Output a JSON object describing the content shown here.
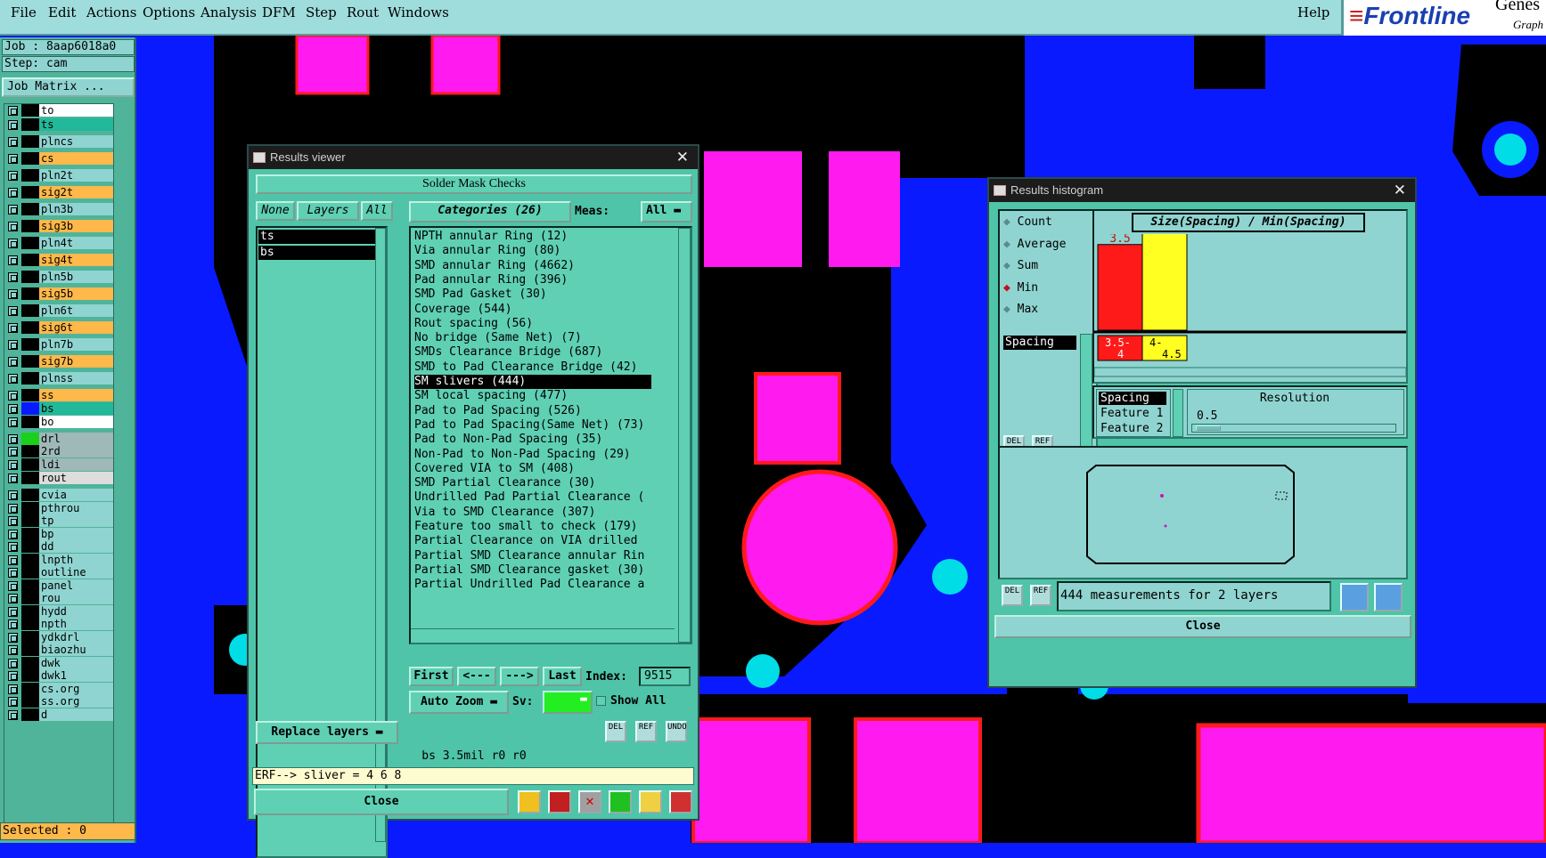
{
  "menubar": {
    "items": [
      "File",
      "Edit",
      "Actions",
      "Options",
      "Analysis",
      "DFM",
      "Step",
      "Rout",
      "Windows"
    ],
    "help": "Help",
    "logo": {
      "brand": "Frontline",
      "suffix_top": "Genes",
      "suffix_bottom": "Graph"
    }
  },
  "job": {
    "job_line": "Job : 8aap6018a0",
    "step_line": "Step: cam",
    "matrix_button": "Job Matrix ..."
  },
  "layers": [
    {
      "name": "to",
      "color": "#ffffff",
      "swatch": "#000000"
    },
    {
      "name": "ts",
      "color": "#22b89a",
      "swatch": "#000000"
    },
    {
      "name": "plncs",
      "color": "#8fd4d0",
      "swatch": "#000000"
    },
    {
      "name": "cs",
      "color": "#ffb84a",
      "swatch": "#000000"
    },
    {
      "name": "pln2t",
      "color": "#8fd4d0",
      "swatch": "#000000"
    },
    {
      "name": "sig2t",
      "color": "#ffb84a",
      "swatch": "#000000"
    },
    {
      "name": "pln3b",
      "color": "#8fd4d0",
      "swatch": "#000000"
    },
    {
      "name": "sig3b",
      "color": "#ffb84a",
      "swatch": "#000000"
    },
    {
      "name": "pln4t",
      "color": "#8fd4d0",
      "swatch": "#000000"
    },
    {
      "name": "sig4t",
      "color": "#ffb84a",
      "swatch": "#000000"
    },
    {
      "name": "pln5b",
      "color": "#8fd4d0",
      "swatch": "#000000"
    },
    {
      "name": "sig5b",
      "color": "#ffb84a",
      "swatch": "#000000"
    },
    {
      "name": "pln6t",
      "color": "#8fd4d0",
      "swatch": "#000000"
    },
    {
      "name": "sig6t",
      "color": "#ffb84a",
      "swatch": "#000000"
    },
    {
      "name": "pln7b",
      "color": "#8fd4d0",
      "swatch": "#000000"
    },
    {
      "name": "sig7b",
      "color": "#ffb84a",
      "swatch": "#000000"
    },
    {
      "name": "plnss",
      "color": "#8fd4d0",
      "swatch": "#000000"
    },
    {
      "name": "ss",
      "color": "#ffb84a",
      "swatch": "#000000"
    },
    {
      "name": "bs",
      "color": "#22b89a",
      "swatch": "#0a1aff"
    },
    {
      "name": "bo",
      "color": "#ffffff",
      "swatch": "#000000"
    },
    {
      "name": "drl",
      "color": "#9fb8b8",
      "swatch": "#1ad01a"
    },
    {
      "name": "2rd",
      "color": "#9fb8b8",
      "swatch": "#000000"
    },
    {
      "name": "ldi",
      "color": "#9fb8b8",
      "swatch": "#000000"
    },
    {
      "name": "rout",
      "color": "#dddddd",
      "swatch": "#000000"
    },
    {
      "name": "cvia",
      "color": "#8fd4d0",
      "swatch": "#000000"
    },
    {
      "name": "pthrou",
      "color": "#8fd4d0",
      "swatch": "#000000"
    },
    {
      "name": "tp",
      "color": "#8fd4d0",
      "swatch": "#000000"
    },
    {
      "name": "bp",
      "color": "#8fd4d0",
      "swatch": "#000000"
    },
    {
      "name": "dd",
      "color": "#8fd4d0",
      "swatch": "#000000"
    },
    {
      "name": "lnpth",
      "color": "#8fd4d0",
      "swatch": "#000000"
    },
    {
      "name": "outline",
      "color": "#8fd4d0",
      "swatch": "#000000"
    },
    {
      "name": "panel",
      "color": "#8fd4d0",
      "swatch": "#000000"
    },
    {
      "name": "rou",
      "color": "#8fd4d0",
      "swatch": "#000000"
    },
    {
      "name": "hydd",
      "color": "#8fd4d0",
      "swatch": "#000000"
    },
    {
      "name": "npth",
      "color": "#8fd4d0",
      "swatch": "#000000"
    },
    {
      "name": "ydkdrl",
      "color": "#8fd4d0",
      "swatch": "#000000"
    },
    {
      "name": "biaozhu",
      "color": "#8fd4d0",
      "swatch": "#000000"
    },
    {
      "name": "dwk",
      "color": "#8fd4d0",
      "swatch": "#000000"
    },
    {
      "name": "dwk1",
      "color": "#8fd4d0",
      "swatch": "#000000"
    },
    {
      "name": "cs.org",
      "color": "#8fd4d0",
      "swatch": "#000000"
    },
    {
      "name": "ss.org",
      "color": "#8fd4d0",
      "swatch": "#000000"
    },
    {
      "name": "d",
      "color": "#8fd4d0",
      "swatch": "#000000"
    }
  ],
  "selected": "Selected : 0",
  "results_viewer": {
    "title": "Results viewer",
    "header": "Solder Mask Checks",
    "none_btn": "None",
    "layers_btn": "Layers",
    "all_btn": "All",
    "layer_items": [
      "ts",
      "bs"
    ],
    "categories_btn": "Categories (26)",
    "meas_label": "Meas:",
    "meas_value": "All",
    "categories": [
      "NPTH annular Ring (12)",
      "Via annular Ring (80)",
      "SMD annular Ring (4662)",
      "Pad annular Ring (396)",
      "SMD Pad Gasket (30)",
      "Coverage (544)",
      "Rout spacing (56)",
      "No bridge (Same Net) (7)",
      "SMDs Clearance Bridge (687)",
      "SMD to Pad Clearance Bridge (42)",
      "SM slivers (444)",
      "SM local spacing (477)",
      "Pad to Pad Spacing (526)",
      "Pad to Pad Spacing(Same Net) (73)",
      "Pad to Non-Pad Spacing (35)",
      "Non-Pad to Non-Pad Spacing (29)",
      "Covered VIA to SM (408)",
      "SMD Partial Clearance (30)",
      "Undrilled Pad Partial Clearance (",
      "Via to SMD Clearance (307)",
      "Feature too small to check (179)",
      "Partial Clearance on VIA drilled",
      "Partial SMD Clearance annular Rin",
      "Partial SMD Clearance gasket (30)",
      "Partial Undrilled Pad Clearance a"
    ],
    "selected_index": 10,
    "first_btn": "First",
    "prev_btn": "<---",
    "next_btn": "--->",
    "last_btn": "Last",
    "index_label": "Index:",
    "index_value": "9515",
    "zoom_btn": "Auto Zoom",
    "sv_label": "Sv:",
    "show_all": "Show All",
    "replace_btn": "Replace layers",
    "status": "bs 3.5mil  r0  r0",
    "erf": "ERF--> sliver = 4 6 8",
    "close": "Close",
    "mini_icons": [
      "DEL",
      "REF",
      "UNDO"
    ]
  },
  "histogram": {
    "title": "Results histogram",
    "options": [
      "Count",
      "Average",
      "Sum",
      "Min",
      "Max"
    ],
    "selected_option": "Min",
    "chart_title": "Size(Spacing) / Min(Spacing)",
    "bars": [
      {
        "label": "3.5",
        "bin": "3.5-\n4",
        "value": 3.5,
        "color": "#ff1a1a"
      },
      {
        "label": "4",
        "bin": "4-\n4.5",
        "value": 4,
        "color": "#ffff22"
      }
    ],
    "measure_item": "Spacing",
    "fields": [
      "Spacing",
      "Feature 1",
      "Feature 2"
    ],
    "resolution_label": "Resolution",
    "resolution_value": "0.5",
    "measurements": "444 measurements for 2 layers",
    "close": "Close",
    "mini_icons": [
      "DEL",
      "REF"
    ]
  }
}
